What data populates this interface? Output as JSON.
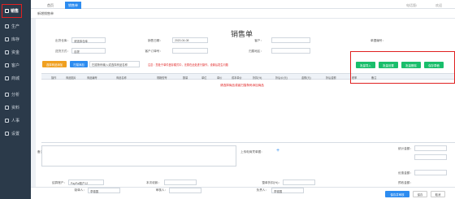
{
  "sidebar": {
    "items": [
      {
        "label": "销售"
      },
      {
        "label": "生产"
      },
      {
        "label": "库存"
      },
      {
        "label": "资金"
      },
      {
        "label": "客户"
      },
      {
        "label": "商城"
      },
      {
        "label": "分析"
      },
      {
        "label": "资料"
      },
      {
        "label": "人事"
      },
      {
        "label": "设置"
      }
    ]
  },
  "topbar": {
    "home_tab": "首页",
    "active_tab": "销售单",
    "user": "电话版/",
    "user2": "欢迎"
  },
  "breadcrumb": "新增销售单",
  "form": {
    "title": "销售单",
    "warehouse_label": "出货仓库：",
    "warehouse_value": "请选择仓库",
    "date_label": "销售日期：",
    "date_value": "2020-04-08",
    "client_label": "客户：",
    "sales_label": "单据编号：",
    "type_label": "送货方式：",
    "type_value": "自提",
    "order_no_label": "客户订单号：",
    "region_label": "归属地区：",
    "warn_text": "注意：您处于单件盘存模式中，无需在此处进行操作，设置后发生问题",
    "add_btn": "选择商品添加",
    "hint_input": "扫描条码输入或选择商品名称",
    "quick_btn": "扫描添加"
  },
  "actions": {
    "btn1": "批量导入",
    "btn2": "批量设置",
    "btn3": "批量删除",
    "btn4": "保存草稿"
  },
  "grid": {
    "headers": [
      "操作",
      "商品图片",
      "商品编号",
      "商品名称",
      "规格型号",
      "数量",
      "单位",
      "单价",
      "成本单价",
      "折扣(%)",
      "折后价(元)",
      "金额(元)",
      "折后金额",
      "税率",
      "备注"
    ],
    "empty": "请选择商品或者扫描条码添加商品"
  },
  "footer": {
    "remark_label": "备注信息",
    "attach_label": "上传电商凭单据：",
    "sum1": "统计金额：",
    "sum2": "优惠金额：",
    "pay_label": "结算账户：",
    "pay_value": "PayPal账户12",
    "recv_label": "本次收款：",
    "disc_label": "整单折扣(%)：",
    "pre_label": "预收金额：",
    "seller_label": "制单人：",
    "seller_value": "李德国",
    "rev_label": "负责人：",
    "rev_value": "李德国",
    "audit_label": "审核人："
  },
  "bottom": {
    "save": "保存并审核",
    "draft": "保存",
    "cancel": "取消"
  }
}
